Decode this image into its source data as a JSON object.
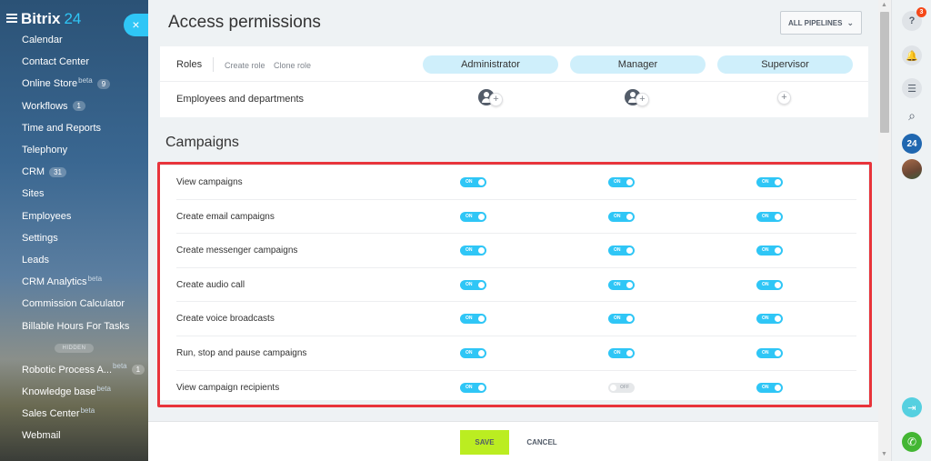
{
  "sidebar": {
    "logo_name": "Bitrix",
    "logo_num": "24",
    "close_label": "×",
    "items": [
      {
        "label": "Calendar"
      },
      {
        "label": "Contact Center"
      },
      {
        "label": "Online Store",
        "sup": "beta",
        "count": "9"
      },
      {
        "label": "Workflows",
        "count": "1"
      },
      {
        "label": "Time and Reports"
      },
      {
        "label": "Telephony"
      },
      {
        "label": "CRM",
        "count": "31"
      },
      {
        "label": "Sites"
      },
      {
        "label": "Employees"
      },
      {
        "label": "Settings"
      },
      {
        "label": "Leads"
      },
      {
        "label": "CRM Analytics",
        "sup": "beta"
      },
      {
        "label": "Commission Calculator"
      },
      {
        "label": "Billable Hours For Tasks"
      },
      {
        "label": "Robotic Process A...",
        "sup": "beta",
        "count": "1"
      },
      {
        "label": "Knowledge base",
        "sup": "beta"
      },
      {
        "label": "Sales Center",
        "sup": "beta"
      },
      {
        "label": "Webmail"
      }
    ],
    "hidden_label": "HIDDEN"
  },
  "header": {
    "title": "Access permissions",
    "pipelines_label": "ALL PIPELINES",
    "pipelines_chevron": "⌄"
  },
  "roles": {
    "label": "Roles",
    "create_role": "Create role",
    "clone_role": "Clone role",
    "names": [
      "Administrator",
      "Manager",
      "Supervisor"
    ],
    "employees_label": "Employees and departments",
    "plus": "+"
  },
  "campaigns": {
    "title": "Campaigns",
    "on_label": "ON",
    "off_label": "OFF",
    "rows": [
      {
        "label": "View campaigns",
        "states": [
          "on",
          "on",
          "on"
        ]
      },
      {
        "label": "Create email campaigns",
        "states": [
          "on",
          "on",
          "on"
        ]
      },
      {
        "label": "Create messenger campaigns",
        "states": [
          "on",
          "on",
          "on"
        ]
      },
      {
        "label": "Create audio call",
        "states": [
          "on",
          "on",
          "on"
        ]
      },
      {
        "label": "Create voice broadcasts",
        "states": [
          "on",
          "on",
          "on"
        ]
      },
      {
        "label": "Run, stop and pause campaigns",
        "states": [
          "on",
          "on",
          "on"
        ]
      },
      {
        "label": "View campaign recipients",
        "states": [
          "on",
          "off",
          "on"
        ]
      }
    ]
  },
  "footer": {
    "save_label": "SAVE",
    "cancel_label": "CANCEL"
  },
  "rightbar": {
    "help": "?",
    "help_badge": "3",
    "bell": "🔔",
    "chat": "☰",
    "search": "⌕",
    "logo24": "24",
    "door": "⇥",
    "phone": "✆"
  },
  "scrollbar": {
    "up": "▲",
    "down": "▼"
  },
  "colors": {
    "accent": "#2fc6f6",
    "save": "#bbed21",
    "highlight": "#e8343b"
  }
}
